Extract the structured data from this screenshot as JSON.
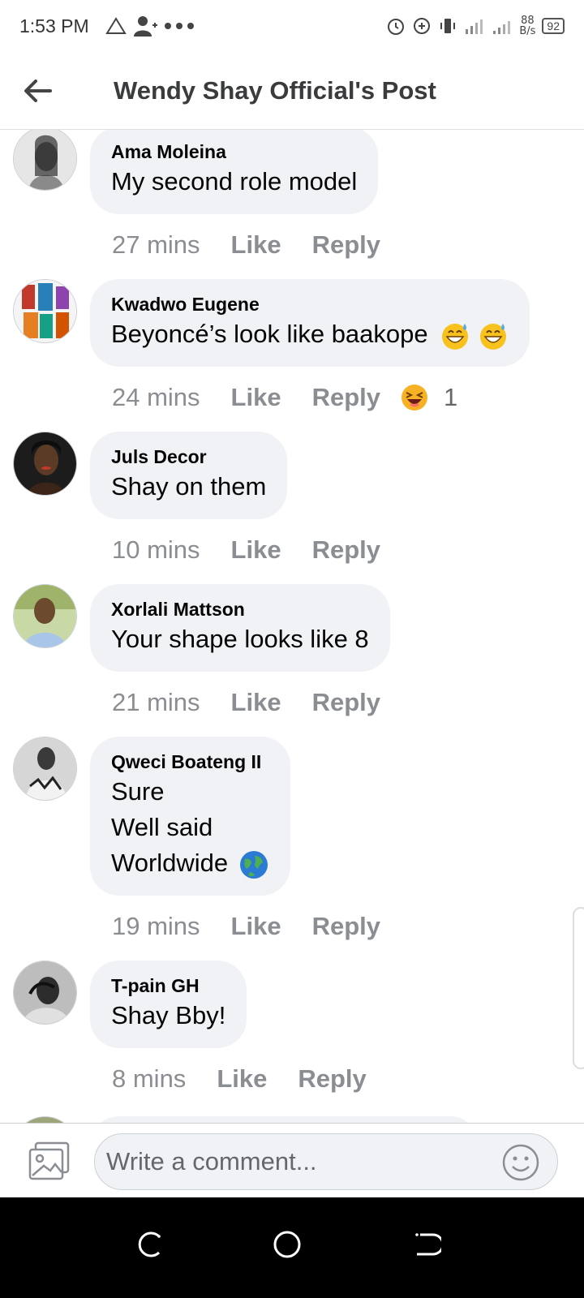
{
  "status_bar": {
    "time": "1:53 PM",
    "left_icons": [
      "alert-triangle-icon",
      "add-person-icon",
      "more-dots-icon"
    ],
    "right_icons": [
      "alarm-icon",
      "data-saver-icon",
      "vibrate-icon",
      "signal-1-icon",
      "signal-2-icon"
    ],
    "speed_value": "88",
    "speed_unit": "B/s",
    "battery": "92"
  },
  "header": {
    "title": "Wendy Shay Official's Post",
    "back_icon": "back-arrow-icon"
  },
  "comments": [
    {
      "author": "Ama Moleina",
      "lines": [
        "My second role model"
      ],
      "time": "27 mins",
      "like": "Like",
      "reply": "Reply"
    },
    {
      "author": "Kwadwo Eugene",
      "lines": [
        "Beyoncé’s look like baakope"
      ],
      "emojis": [
        "grinning-sweat-emoji",
        "grinning-sweat-emoji"
      ],
      "time": "24 mins",
      "like": "Like",
      "reply": "Reply",
      "reaction": {
        "icon": "haha-reaction-icon",
        "count": "1"
      }
    },
    {
      "author": "Juls Decor",
      "lines": [
        "Shay on them"
      ],
      "time": "10 mins",
      "like": "Like",
      "reply": "Reply"
    },
    {
      "author": "Xorlali Mattson",
      "lines": [
        "Your shape looks like 8"
      ],
      "time": "21 mins",
      "like": "Like",
      "reply": "Reply"
    },
    {
      "author": "Qweci Boateng II",
      "lines": [
        "Sure",
        "Well said",
        "Worldwide"
      ],
      "emojis": [
        "globe-emoji"
      ],
      "time": "19 mins",
      "like": "Like",
      "reply": "Reply"
    },
    {
      "author": "T-pain GH",
      "lines": [
        "Shay Bby!"
      ],
      "time": "8 mins",
      "like": "Like",
      "reply": "Reply"
    }
  ],
  "composer": {
    "placeholder": "Write a comment...",
    "photo_icon": "photo-icon",
    "emoji_icon": "emoji-picker-icon"
  },
  "nav_bar": {
    "icons": [
      "recents-icon",
      "home-icon",
      "back-icon"
    ]
  }
}
